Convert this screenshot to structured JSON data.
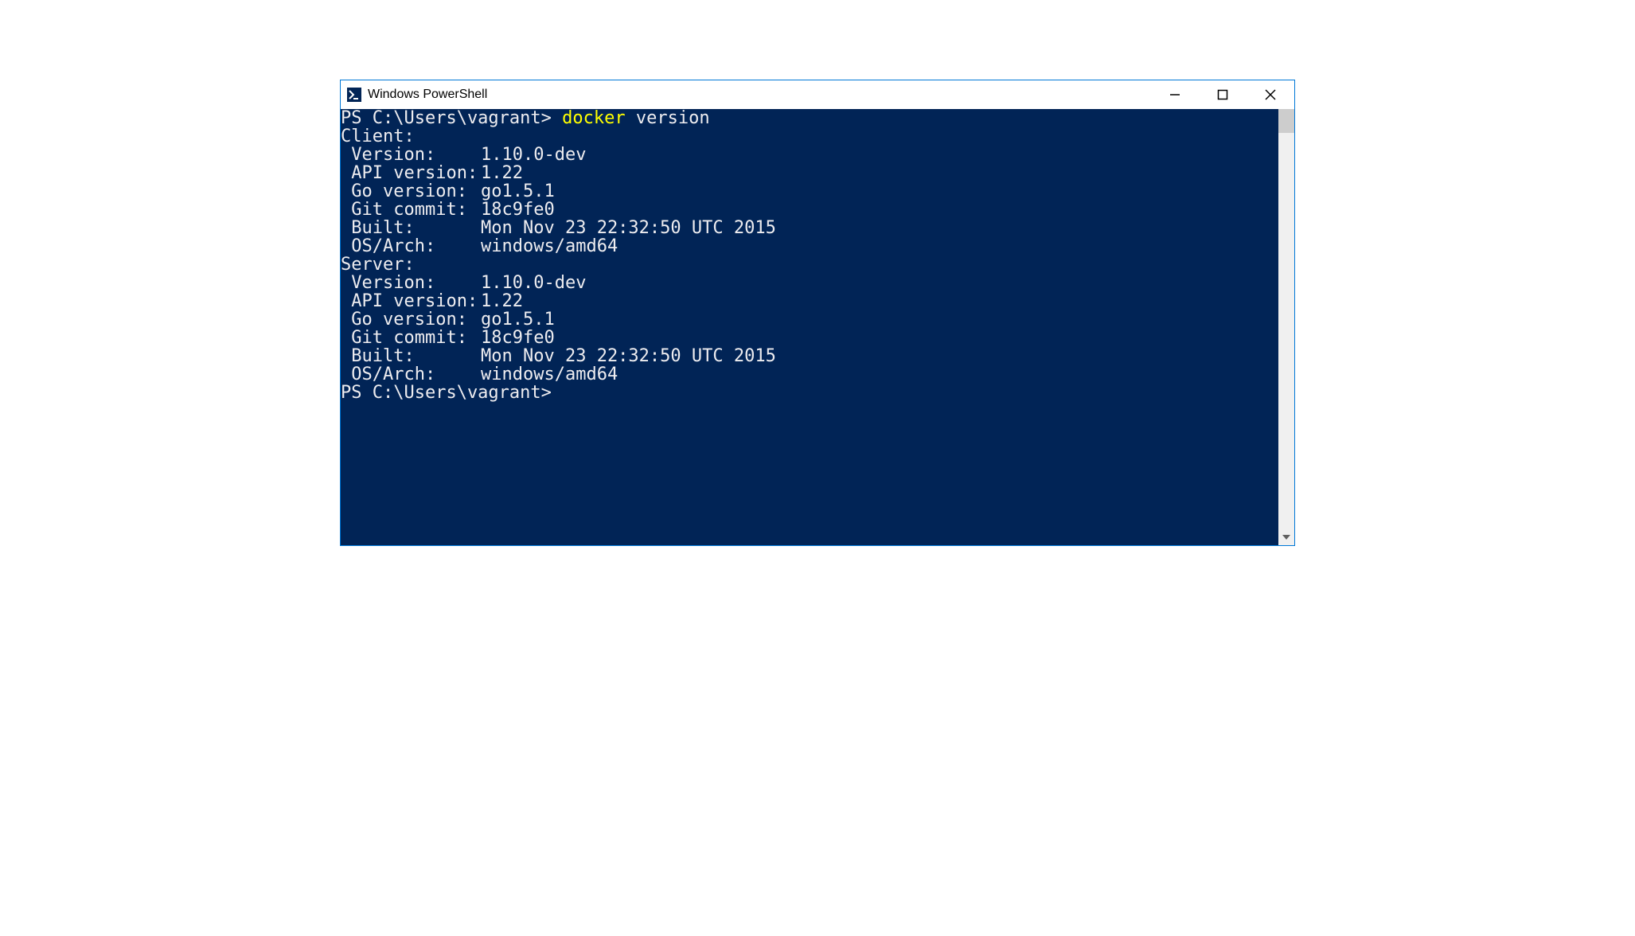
{
  "window": {
    "title": "Windows PowerShell"
  },
  "prompt1": {
    "ps": "PS C:\\Users\\vagrant>",
    "cmd": "docker",
    "arg": "version"
  },
  "output": {
    "client_header": "Client:",
    "client": {
      "version_k": " Version:",
      "version_v": "1.10.0-dev",
      "api_k": " API version:",
      "api_v": "1.22",
      "go_k": " Go version:",
      "go_v": "go1.5.1",
      "git_k": " Git commit:",
      "git_v": "18c9fe0",
      "built_k": " Built:",
      "built_v": "Mon Nov 23 22:32:50 UTC 2015",
      "os_k": " OS/Arch:",
      "os_v": "windows/amd64"
    },
    "blank": "",
    "server_header": "Server:",
    "server": {
      "version_k": " Version:",
      "version_v": "1.10.0-dev",
      "api_k": " API version:",
      "api_v": "1.22",
      "go_k": " Go version:",
      "go_v": "go1.5.1",
      "git_k": " Git commit:",
      "git_v": "18c9fe0",
      "built_k": " Built:",
      "built_v": "Mon Nov 23 22:32:50 UTC 2015",
      "os_k": " OS/Arch:",
      "os_v": "windows/amd64"
    }
  },
  "prompt2": {
    "ps": "PS C:\\Users\\vagrant>"
  }
}
